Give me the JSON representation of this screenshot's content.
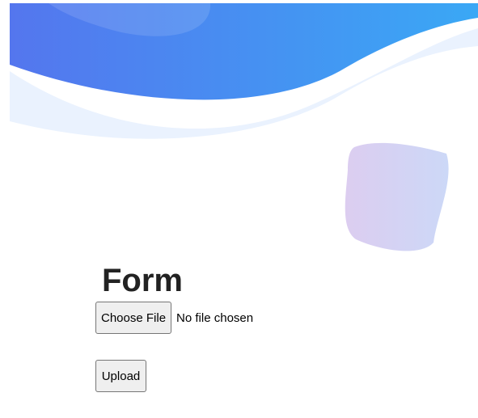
{
  "colors": {
    "wave_gradient_start": "#5476ee",
    "wave_gradient_end": "#3aa8f5",
    "wave_light": "#eaf2fe",
    "blob_gradient_start": "#dccdf0",
    "blob_gradient_end": "#ccd8f7",
    "title_text": "#222222",
    "button_bg": "#efefef",
    "button_border": "#767676"
  },
  "icons": [
    "wave-header-decoration",
    "blob-decoration"
  ],
  "form": {
    "title": "Form",
    "file_input": {
      "button_label": "Choose File",
      "status": "No file chosen"
    },
    "upload_label": "Upload"
  }
}
